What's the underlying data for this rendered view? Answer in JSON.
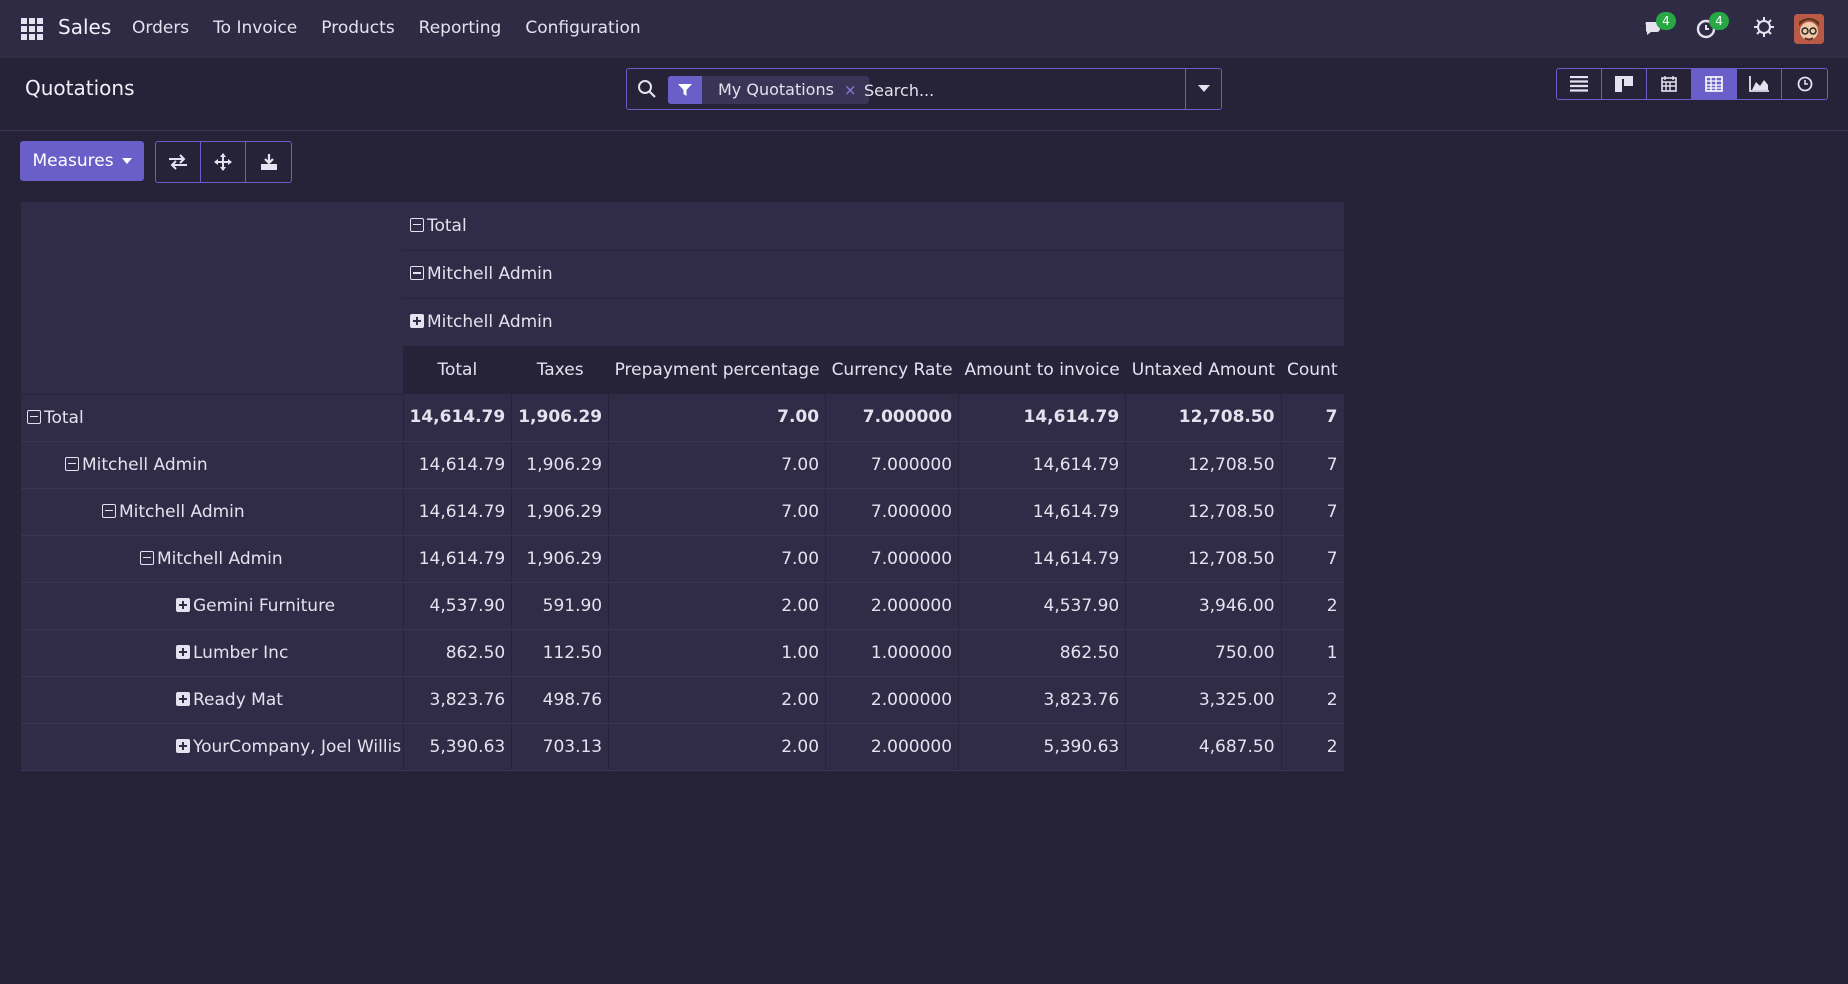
{
  "navbar": {
    "brand": "Sales",
    "menu": [
      "Orders",
      "To Invoice",
      "Products",
      "Reporting",
      "Configuration"
    ],
    "messages_count": "4",
    "activities_count": "4"
  },
  "control_panel": {
    "title": "Quotations",
    "search": {
      "facet": "My Quotations",
      "placeholder": "Search..."
    },
    "views": [
      "list-view-icon",
      "kanban-view-icon",
      "calendar-view-icon",
      "pivot-view-icon",
      "graph-view-icon",
      "activity-view-icon"
    ],
    "active_view": "pivot-view-icon"
  },
  "toolbar": {
    "measures_label": "Measures"
  },
  "pivot": {
    "col_headers": [
      "Total",
      "Mitchell Admin",
      "Mitchell Admin"
    ],
    "measures": [
      "Total",
      "Taxes",
      "Prepayment percentage",
      "Currency Rate",
      "Amount to invoice",
      "Untaxed Amount",
      "Count"
    ],
    "rows": [
      {
        "label": "Total",
        "level": 0,
        "expanded": true,
        "values": [
          "14,614.79",
          "1,906.29",
          "7.00",
          "7.000000",
          "14,614.79",
          "12,708.50",
          "7"
        ]
      },
      {
        "label": "Mitchell Admin",
        "level": 1,
        "expanded": true,
        "values": [
          "14,614.79",
          "1,906.29",
          "7.00",
          "7.000000",
          "14,614.79",
          "12,708.50",
          "7"
        ]
      },
      {
        "label": "Mitchell Admin",
        "level": 2,
        "expanded": true,
        "values": [
          "14,614.79",
          "1,906.29",
          "7.00",
          "7.000000",
          "14,614.79",
          "12,708.50",
          "7"
        ]
      },
      {
        "label": "Mitchell Admin",
        "level": 3,
        "expanded": true,
        "values": [
          "14,614.79",
          "1,906.29",
          "7.00",
          "7.000000",
          "14,614.79",
          "12,708.50",
          "7"
        ]
      },
      {
        "label": "Gemini Furniture",
        "level": 4,
        "expanded": false,
        "values": [
          "4,537.90",
          "591.90",
          "2.00",
          "2.000000",
          "4,537.90",
          "3,946.00",
          "2"
        ]
      },
      {
        "label": "Lumber Inc",
        "level": 4,
        "expanded": false,
        "values": [
          "862.50",
          "112.50",
          "1.00",
          "1.000000",
          "862.50",
          "750.00",
          "1"
        ]
      },
      {
        "label": "Ready Mat",
        "level": 4,
        "expanded": false,
        "values": [
          "3,823.76",
          "498.76",
          "2.00",
          "2.000000",
          "3,823.76",
          "3,325.00",
          "2"
        ]
      },
      {
        "label": "YourCompany, Joel Willis",
        "level": 4,
        "expanded": false,
        "values": [
          "5,390.63",
          "703.13",
          "2.00",
          "2.000000",
          "5,390.63",
          "4,687.50",
          "2"
        ]
      }
    ]
  },
  "colors": {
    "background": "#262339",
    "navbar": "#2f2b45",
    "accent": "#6a5fc8",
    "badge": "#28a745"
  }
}
